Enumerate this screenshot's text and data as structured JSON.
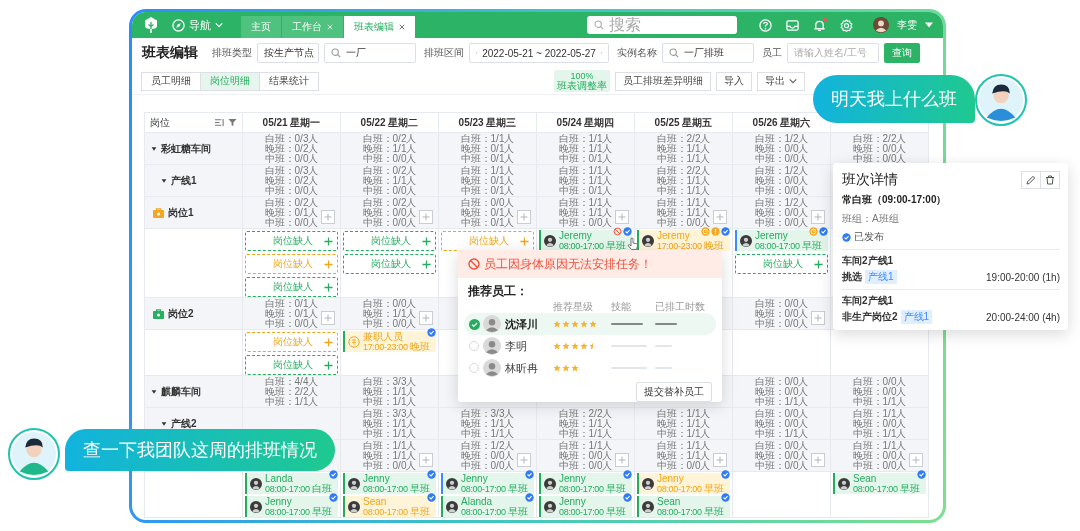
{
  "topbar": {
    "nav_label": "导航",
    "tabs": [
      {
        "label": "主页",
        "closable": false,
        "selected": false
      },
      {
        "label": "工作台",
        "closable": true,
        "selected": false
      },
      {
        "label": "班表编辑",
        "closable": true,
        "selected": true
      }
    ],
    "search": {
      "placeholder": "搜索"
    },
    "notifications_unread": true,
    "user": "李雯"
  },
  "toolbar": {
    "title": "班表编辑",
    "filters": [
      {
        "kind": "select",
        "label": "排班类型",
        "value": "按生产节点"
      },
      {
        "kind": "search",
        "value": "一厂"
      },
      {
        "kind": "range",
        "label": "排班区间",
        "value": "2022-05-21 ~ 2022-05-27"
      },
      {
        "kind": "search",
        "label": "实例名称",
        "value": "一厂排班"
      },
      {
        "kind": "input",
        "label": "员工",
        "placeholder": "请输入姓名/工号"
      }
    ],
    "query_button": "查询"
  },
  "view_tabs": [
    {
      "label": "员工明细",
      "selected": false
    },
    {
      "label": "岗位明细",
      "selected": true
    },
    {
      "label": "结果统计",
      "selected": false
    }
  ],
  "rate": {
    "value": "100%",
    "label": "班表调整率"
  },
  "actions": [
    {
      "label": "员工排班差异明细",
      "caret": false
    },
    {
      "label": "导入",
      "caret": false
    },
    {
      "label": "导出",
      "caret": true
    }
  ],
  "table": {
    "corner": "岗位",
    "columns": [
      "05/21 星期一",
      "05/22 星期二",
      "05/23 星期三",
      "05/24 星期四",
      "05/25 星期五",
      "05/26 星期六"
    ],
    "workshops": [
      {
        "label": "彩虹糖车间",
        "expanded": true,
        "cells": [
          {
            "kind": "counts",
            "lines": [
              "白班：0/3人",
              "晚班：0/2人",
              "中班：0/0人"
            ]
          },
          {
            "kind": "counts",
            "lines": [
              "白班：0/2人",
              "晚班：1/1人",
              "中班：0/0人"
            ]
          },
          {
            "kind": "counts",
            "lines": [
              "白班：1/1人",
              "晚班：0/1人",
              "中班：0/1人"
            ]
          },
          {
            "kind": "counts",
            "lines": [
              "白班：1/1人",
              "晚班：1/1人",
              "中班：0/1人"
            ]
          },
          {
            "kind": "counts",
            "lines": [
              "白班：2/2人",
              "晚班：1/1人",
              "中班：1/1人"
            ]
          },
          {
            "kind": "counts",
            "lines": [
              "白班：1/2人",
              "晚班：0/0人",
              "中班：0/0人"
            ]
          },
          {
            "kind": "counts",
            "lines": [
              "白班：2/2人",
              "晚班：0/0人",
              "中班：0/0人"
            ]
          }
        ],
        "children": [
          {
            "label": "产线1",
            "expanded": true,
            "cells": [
              {
                "kind": "counts",
                "lines": [
                  "白班：0/3人",
                  "晚班：0/2人",
                  "中班：0/0人"
                ]
              },
              {
                "kind": "counts",
                "lines": [
                  "白班：0/2人",
                  "晚班：1/1人",
                  "中班：0/0人"
                ]
              },
              {
                "kind": "counts",
                "lines": [
                  "白班：1/1人",
                  "晚班：0/1人",
                  "中班：0/1人"
                ]
              },
              {
                "kind": "counts",
                "lines": [
                  "白班：1/1人",
                  "晚班：1/1人",
                  "中班：0/1人"
                ]
              },
              {
                "kind": "counts",
                "lines": [
                  "白班：2/2人",
                  "晚班：1/1人",
                  "中班：1/1人"
                ]
              },
              {
                "kind": "counts",
                "lines": [
                  "白班：1/2人",
                  "晚班：0/0人",
                  "中班：0/0人"
                ]
              },
              {
                "kind": "empty"
              }
            ],
            "children": [
              {
                "label": "岗位1",
                "color": "#f5a623",
                "cells": [
                  {
                    "kind": "counts",
                    "lines": [
                      "白班：0/2人",
                      "晚班：0/1人",
                      "中班：0/0人"
                    ]
                  },
                  {
                    "kind": "counts",
                    "lines": [
                      "白班：0/2人",
                      "晚班：0/0人",
                      "中班：0/0人"
                    ]
                  },
                  {
                    "kind": "counts",
                    "lines": [
                      "白班：0/0人",
                      "晚班：0/1人",
                      "中班：0/1人"
                    ]
                  },
                  {
                    "kind": "counts",
                    "lines": [
                      "白班：1/1人",
                      "晚班：1/1人",
                      "中班：0/0人"
                    ]
                  },
                  {
                    "kind": "counts",
                    "lines": [
                      "白班：1/1人",
                      "晚班：1/1人",
                      "中班：0/0人"
                    ]
                  },
                  {
                    "kind": "counts",
                    "lines": [
                      "白班：1/2人",
                      "晚班：0/0人",
                      "中班：0/0人"
                    ]
                  },
                  {
                    "kind": "empty"
                  }
                ],
                "slots": [
                  [
                    {
                      "kind": "vacancy",
                      "label": "岗位缺人",
                      "color": "#25ad5f"
                    },
                    {
                      "kind": "vacancy",
                      "label": "岗位缺人",
                      "color": "#25ad5f"
                    },
                    {
                      "kind": "vacancy",
                      "label": "岗位缺人",
                      "color": "#f2a516"
                    },
                    {
                      "kind": "shift",
                      "name": "Jeremy",
                      "time": "08:00-17:00",
                      "shift": "早班",
                      "highlighted": false,
                      "accent": {
                        "color": "#25ad5f"
                      },
                      "badges": [
                        {
                          "kind": "blocked"
                        },
                        {
                          "kind": "published"
                        }
                      ],
                      "pointer": true
                    },
                    {
                      "kind": "shift",
                      "name": "Jeremy",
                      "time": "17:00-23:00",
                      "shift": "晚班",
                      "highlighted": true,
                      "accent": {
                        "color": "#25ad5f"
                      },
                      "badges": [
                        {
                          "kind": "clock"
                        },
                        {
                          "kind": "alert"
                        },
                        {
                          "kind": "published"
                        }
                      ]
                    },
                    {
                      "kind": "shift",
                      "name": "Jeremy",
                      "time": "08:00-17:00",
                      "shift": "早班",
                      "highlighted": false,
                      "accent": {
                        "color": "#3d8bfd"
                      },
                      "badges": [
                        {
                          "kind": "clock"
                        },
                        {
                          "kind": "published"
                        }
                      ]
                    },
                    {
                      "kind": "hidden"
                    }
                  ],
                  [
                    {
                      "kind": "vacancy",
                      "label": "岗位缺人",
                      "color": "#f2a516"
                    },
                    {
                      "kind": "vacancy",
                      "label": "岗位缺人",
                      "color": "#25ad5f"
                    },
                    {
                      "kind": "hidden"
                    },
                    {
                      "kind": "hidden"
                    },
                    {
                      "kind": "empty"
                    },
                    {
                      "kind": "vacancy",
                      "label": "岗位缺人",
                      "color": "#25ad5f"
                    },
                    {
                      "kind": "hidden"
                    }
                  ],
                  [
                    {
                      "kind": "vacancy",
                      "label": "岗位缺人",
                      "color": "#25ad5f"
                    },
                    {
                      "kind": "empty"
                    },
                    {
                      "kind": "empty"
                    },
                    {
                      "kind": "empty"
                    },
                    {
                      "kind": "empty"
                    },
                    {
                      "kind": "empty"
                    },
                    {
                      "kind": "empty"
                    }
                  ]
                ]
              },
              {
                "label": "岗位2",
                "color": "#27b060",
                "cells": [
                  {
                    "kind": "counts",
                    "lines": [
                      "白班：0/1人",
                      "晚班：0/1人",
                      "中班：0/0人"
                    ]
                  },
                  {
                    "kind": "counts",
                    "lines": [
                      "白班：0/0人",
                      "晚班：1/1人",
                      "中班：0/0人"
                    ]
                  },
                  {
                    "kind": "empty"
                  },
                  {
                    "kind": "empty"
                  },
                  {
                    "kind": "empty"
                  },
                  {
                    "kind": "counts",
                    "lines": [
                      "白班：0/0人",
                      "晚班：0/0人",
                      "中班：0/0人"
                    ]
                  },
                  {
                    "kind": "empty"
                  }
                ],
                "slots": [
                  [
                    {
                      "kind": "vacancy",
                      "label": "岗位缺人",
                      "color": "#f2a516"
                    },
                    {
                      "kind": "shift",
                      "name": "兼职人员",
                      "time": "17:00-23:00",
                      "shift": "晚班",
                      "highlighted": true,
                      "accent": {
                        "color": "#25ad5f"
                      },
                      "part_time": true,
                      "badges": [
                        {
                          "kind": "published"
                        }
                      ]
                    },
                    {
                      "kind": "empty"
                    },
                    {
                      "kind": "empty"
                    },
                    {
                      "kind": "empty"
                    },
                    {
                      "kind": "empty"
                    },
                    {
                      "kind": "empty"
                    }
                  ],
                  [
                    {
                      "kind": "vacancy",
                      "label": "岗位缺人",
                      "color": "#25ad5f"
                    },
                    {
                      "kind": "empty"
                    },
                    {
                      "kind": "empty"
                    },
                    {
                      "kind": "empty"
                    },
                    {
                      "kind": "empty"
                    },
                    {
                      "kind": "empty"
                    },
                    {
                      "kind": "empty"
                    }
                  ]
                ]
              }
            ]
          }
        ]
      },
      {
        "label": "麒麟车间",
        "expanded": true,
        "cells": [
          {
            "kind": "counts",
            "lines": [
              "白班：4/4人",
              "晚班：2/2人",
              "中班：1/1人"
            ]
          },
          {
            "kind": "counts",
            "lines": [
              "白班：3/3人",
              "晚班：1/1人",
              "中班：1/1人"
            ]
          },
          {
            "kind": "empty"
          },
          {
            "kind": "empty"
          },
          {
            "kind": "empty"
          },
          {
            "kind": "counts",
            "lines": [
              "白班：0/0人",
              "晚班：0/0人",
              "中班：1/1人"
            ]
          },
          {
            "kind": "counts",
            "lines": [
              "白班：0/0人",
              "晚班：0/0人",
              "中班：1/1人"
            ]
          }
        ],
        "children": [
          {
            "label": "产线2",
            "expanded": true,
            "cells": [
              {
                "kind": "empty"
              },
              {
                "kind": "counts",
                "lines": [
                  "白班：3/3人",
                  "晚班：1/1人",
                  "中班：1/1人"
                ]
              },
              {
                "kind": "counts",
                "lines": [
                  "白班：3/3人",
                  "晚班：1/1人",
                  "中班：1/1人"
                ]
              },
              {
                "kind": "counts",
                "lines": [
                  "白班：2/2人",
                  "晚班：1/1人",
                  "中班：1/1人"
                ]
              },
              {
                "kind": "counts",
                "lines": [
                  "白班：1/1人",
                  "晚班：1/1人",
                  "中班：1/1人"
                ]
              },
              {
                "kind": "counts",
                "lines": [
                  "白班：0/0人",
                  "晚班：0/0人",
                  "中班：1/1人"
                ]
              },
              {
                "kind": "counts",
                "lines": [
                  "白班：1/1人",
                  "晚班：0/0人",
                  "中班：1/1人"
                ]
              }
            ],
            "children": [
              {
                "cells": [
                  {
                    "kind": "empty"
                  },
                  {
                    "kind": "counts",
                    "lines": [
                      "白班：1/1人",
                      "晚班：1/1人",
                      "中班：0/0人"
                    ]
                  },
                  {
                    "kind": "counts",
                    "lines": [
                      "白班：1/2人",
                      "晚班：0/0人",
                      "中班：0/0人"
                    ]
                  },
                  {
                    "kind": "counts",
                    "lines": [
                      "白班：1/1人",
                      "晚班：0/0人",
                      "中班：0/0人"
                    ]
                  },
                  {
                    "kind": "counts",
                    "lines": [
                      "白班：1/1人",
                      "晚班：1/1人",
                      "中班：0/0人"
                    ]
                  },
                  {
                    "kind": "counts",
                    "lines": [
                      "白班：0/0人",
                      "晚班：0/0人",
                      "中班：0/0人"
                    ]
                  },
                  {
                    "kind": "counts",
                    "lines": [
                      "白班：1/1人",
                      "晚班：0/0人",
                      "中班：0/0人"
                    ]
                  }
                ],
                "slots": [
                  [
                    {
                      "kind": "shift",
                      "name": "Landa",
                      "time": "08:00-17:00",
                      "shift": "白班",
                      "highlighted": false,
                      "accent": {
                        "color": "#25ad5f"
                      },
                      "badges": [
                        {
                          "kind": "published"
                        }
                      ]
                    },
                    {
                      "kind": "shift",
                      "name": "Jenny",
                      "time": "08:00-17:00",
                      "shift": "早班",
                      "highlighted": false,
                      "accent": {
                        "color": "#25ad5f"
                      },
                      "badges": [
                        {
                          "kind": "published"
                        }
                      ]
                    },
                    {
                      "kind": "shift",
                      "name": "Jenny",
                      "time": "08:00-17:00",
                      "shift": "早班",
                      "highlighted": false,
                      "accent": {
                        "color": "#3d8bfd"
                      },
                      "badges": [
                        {
                          "kind": "published"
                        }
                      ]
                    },
                    {
                      "kind": "shift",
                      "name": "Jenny",
                      "time": "08:00-17:00",
                      "shift": "早班",
                      "highlighted": false,
                      "accent": {
                        "color": "#25ad5f"
                      },
                      "badges": [
                        {
                          "kind": "published"
                        }
                      ]
                    },
                    {
                      "kind": "shift",
                      "name": "Jenny",
                      "time": "08:00-17:00",
                      "shift": "早班",
                      "highlighted": true,
                      "accent": {
                        "color": "#25ad5f"
                      },
                      "badges": [
                        {
                          "kind": "published"
                        }
                      ]
                    },
                    {
                      "kind": "empty"
                    },
                    {
                      "kind": "shift",
                      "name": "Sean",
                      "time": "08:00-17:00",
                      "shift": "早班",
                      "highlighted": false,
                      "accent": {
                        "color": "#25ad5f"
                      },
                      "badges": [
                        {
                          "kind": "published"
                        }
                      ]
                    }
                  ],
                  [
                    {
                      "kind": "shift",
                      "name": "Jenny",
                      "time": "08:00-17:00",
                      "shift": "早班",
                      "highlighted": false,
                      "accent": {
                        "color": "#25ad5f"
                      },
                      "badges": [
                        {
                          "kind": "published"
                        }
                      ]
                    },
                    {
                      "kind": "shift",
                      "name": "Sean",
                      "time": "08:00-17:00",
                      "shift": "早班",
                      "highlighted": true,
                      "accent": {
                        "color": "#25ad5f"
                      },
                      "badges": [
                        {
                          "kind": "published"
                        }
                      ]
                    },
                    {
                      "kind": "shift",
                      "name": "Alanda",
                      "time": "08:00-17:00",
                      "shift": "早班",
                      "highlighted": false,
                      "accent": {
                        "color": "#25ad5f"
                      },
                      "badges": [
                        {
                          "kind": "published"
                        }
                      ]
                    },
                    {
                      "kind": "shift",
                      "name": "Jenny",
                      "time": "08:00-17:00",
                      "shift": "早班",
                      "highlighted": false,
                      "accent": {
                        "color": "#25ad5f"
                      },
                      "badges": [
                        {
                          "kind": "published"
                        }
                      ]
                    },
                    {
                      "kind": "shift",
                      "name": "Sean",
                      "time": "08:00-17:00",
                      "shift": "早班",
                      "highlighted": false,
                      "accent": {
                        "color": "#25ad5f"
                      },
                      "badges": [
                        {
                          "kind": "published"
                        }
                      ]
                    },
                    {
                      "kind": "empty"
                    },
                    {
                      "kind": "empty"
                    }
                  ]
                ]
              }
            ]
          }
        ]
      }
    ]
  },
  "replacement_popup": {
    "warning": "员工因身体原因无法安排任务！",
    "title": "推荐员工：",
    "columns": [
      "推荐星级",
      "技能",
      "已排工时数"
    ],
    "candidates": [
      {
        "name": "沈泽川",
        "selected": true,
        "stars": 5
      },
      {
        "name": "李明",
        "selected": false,
        "stars": 4.5
      },
      {
        "name": "林昕冉",
        "selected": false,
        "stars": 3
      }
    ],
    "submit": "提交替补员工"
  },
  "shift_detail": {
    "title": "班次详情",
    "shift": "常白班（09:00-17:00）",
    "team": "班组：A班组",
    "status": "已发布",
    "tasks": [
      {
        "location": "车间2产线1",
        "name": "挑选",
        "tag": "产线1",
        "time": "19:00-20:00 (1h)"
      },
      {
        "location": "车间2产线1",
        "name": "非生产岗位2",
        "tag": "产线1",
        "time": "20:00-24:00 (4h)"
      }
    ]
  },
  "chat_bubbles": [
    {
      "text": "明天我上什么班"
    },
    {
      "text": "查一下我团队这周的排班情况"
    }
  ]
}
